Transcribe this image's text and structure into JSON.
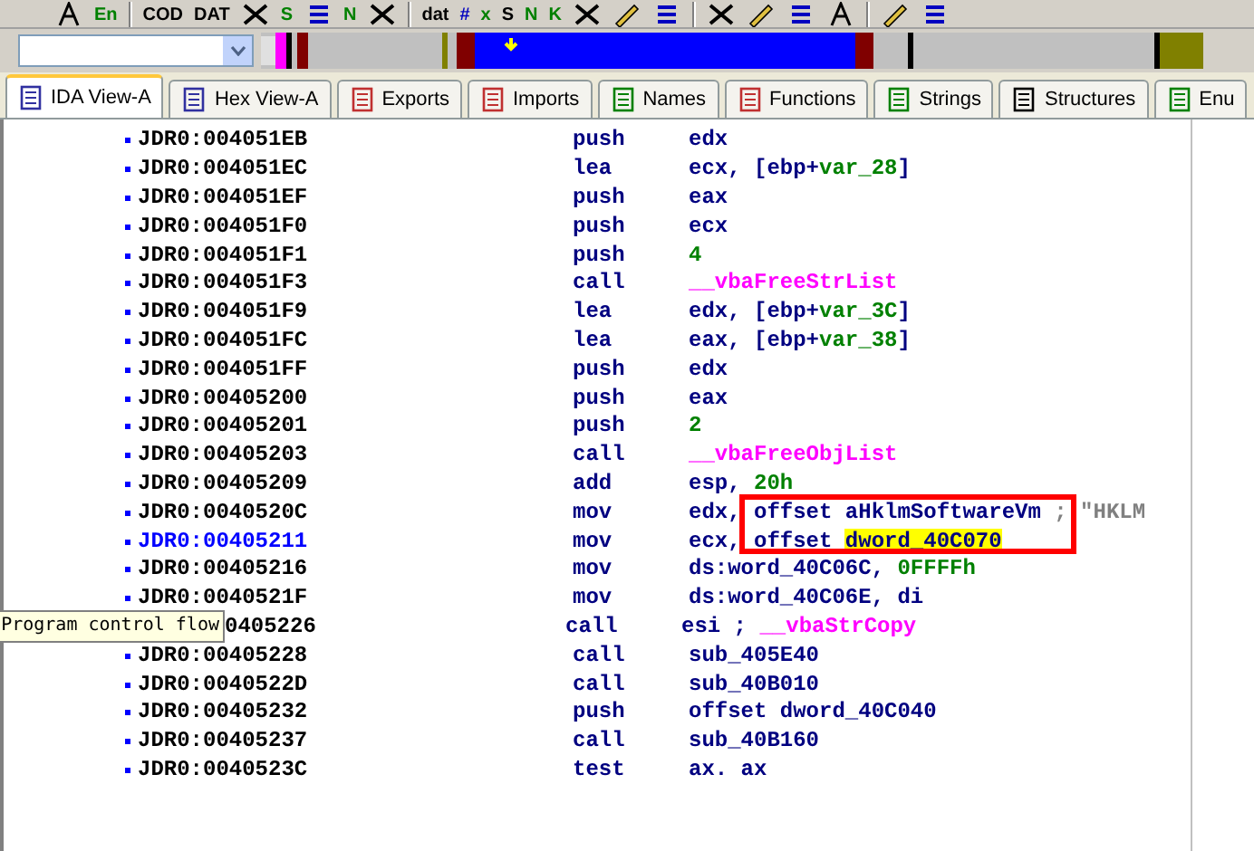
{
  "toolbar": [
    {
      "kind": "icon"
    },
    {
      "kind": "text",
      "label": "En",
      "color": "#008000"
    },
    {
      "kind": "sep"
    },
    {
      "kind": "text",
      "label": "COD",
      "color": "#000000"
    },
    {
      "kind": "text",
      "label": "DAT",
      "color": "#000000"
    },
    {
      "kind": "icon"
    },
    {
      "kind": "text",
      "label": "S",
      "color": "#008000"
    },
    {
      "kind": "icon"
    },
    {
      "kind": "text",
      "label": "N",
      "color": "#008000"
    },
    {
      "kind": "icon"
    },
    {
      "kind": "sep"
    },
    {
      "kind": "text",
      "label": "dat",
      "color": "#000000"
    },
    {
      "kind": "text",
      "label": "#",
      "color": "#0000c0"
    },
    {
      "kind": "text",
      "label": "x",
      "color": "#008000"
    },
    {
      "kind": "text",
      "label": "S",
      "color": "#000000"
    },
    {
      "kind": "text",
      "label": "N",
      "color": "#008000"
    },
    {
      "kind": "text",
      "label": "K",
      "color": "#008000"
    },
    {
      "kind": "icon"
    },
    {
      "kind": "icon"
    },
    {
      "kind": "icon"
    },
    {
      "kind": "sep"
    },
    {
      "kind": "icon"
    },
    {
      "kind": "icon"
    },
    {
      "kind": "icon"
    },
    {
      "kind": "icon"
    },
    {
      "kind": "sep"
    },
    {
      "kind": "icon"
    },
    {
      "kind": "icon"
    }
  ],
  "tabs": [
    {
      "label": "IDA View-A",
      "selected": true
    },
    {
      "label": "Hex View-A",
      "selected": false
    },
    {
      "label": "Exports",
      "selected": false
    },
    {
      "label": "Imports",
      "selected": false
    },
    {
      "label": "Names",
      "selected": false
    },
    {
      "label": "Functions",
      "selected": false
    },
    {
      "label": "Strings",
      "selected": false
    },
    {
      "label": "Structures",
      "selected": false
    },
    {
      "label": "Enu",
      "selected": false
    }
  ],
  "listing": [
    {
      "address": "JDR0:004051EB",
      "current": false,
      "mnemonic": "push",
      "operand": [
        {
          "kind": "reg",
          "text": "edx"
        }
      ]
    },
    {
      "address": "JDR0:004051EC",
      "current": false,
      "mnemonic": "lea",
      "operand": [
        {
          "kind": "reg",
          "text": "ecx, [ebp+"
        },
        {
          "kind": "var",
          "text": "var_28"
        },
        {
          "kind": "reg",
          "text": "]"
        }
      ]
    },
    {
      "address": "JDR0:004051EF",
      "current": false,
      "mnemonic": "push",
      "operand": [
        {
          "kind": "reg",
          "text": "eax"
        }
      ]
    },
    {
      "address": "JDR0:004051F0",
      "current": false,
      "mnemonic": "push",
      "operand": [
        {
          "kind": "reg",
          "text": "ecx"
        }
      ]
    },
    {
      "address": "JDR0:004051F1",
      "current": false,
      "mnemonic": "push",
      "operand": [
        {
          "kind": "num",
          "text": "4"
        }
      ]
    },
    {
      "address": "JDR0:004051F3",
      "current": false,
      "mnemonic": "call",
      "operand": [
        {
          "kind": "func",
          "text": "__vbaFreeStrList"
        }
      ]
    },
    {
      "address": "JDR0:004051F9",
      "current": false,
      "mnemonic": "lea",
      "operand": [
        {
          "kind": "reg",
          "text": "edx, [ebp+"
        },
        {
          "kind": "var",
          "text": "var_3C"
        },
        {
          "kind": "reg",
          "text": "]"
        }
      ]
    },
    {
      "address": "JDR0:004051FC",
      "current": false,
      "mnemonic": "lea",
      "operand": [
        {
          "kind": "reg",
          "text": "eax, [ebp+"
        },
        {
          "kind": "var",
          "text": "var_38"
        },
        {
          "kind": "reg",
          "text": "]"
        }
      ]
    },
    {
      "address": "JDR0:004051FF",
      "current": false,
      "mnemonic": "push",
      "operand": [
        {
          "kind": "reg",
          "text": "edx"
        }
      ]
    },
    {
      "address": "JDR0:00405200",
      "current": false,
      "mnemonic": "push",
      "operand": [
        {
          "kind": "reg",
          "text": "eax"
        }
      ]
    },
    {
      "address": "JDR0:00405201",
      "current": false,
      "mnemonic": "push",
      "operand": [
        {
          "kind": "num",
          "text": "2"
        }
      ]
    },
    {
      "address": "JDR0:00405203",
      "current": false,
      "mnemonic": "call",
      "operand": [
        {
          "kind": "func",
          "text": "__vbaFreeObjList"
        }
      ]
    },
    {
      "address": "JDR0:00405209",
      "current": false,
      "mnemonic": "add",
      "operand": [
        {
          "kind": "reg",
          "text": "esp, "
        },
        {
          "kind": "num",
          "text": "20h"
        }
      ]
    },
    {
      "address": "JDR0:0040520C",
      "current": false,
      "mnemonic": "mov",
      "operand": [
        {
          "kind": "reg",
          "text": "edx, offset aHklmSoftwareVm"
        },
        {
          "kind": "comment",
          "text": " ; \"HKLM"
        }
      ]
    },
    {
      "address": "JDR0:00405211",
      "current": true,
      "mnemonic": "mov",
      "operand": [
        {
          "kind": "reg",
          "text": "ecx, offset "
        },
        {
          "kind": "highlight",
          "text": "dword_40C070"
        }
      ]
    },
    {
      "address": "JDR0:00405216",
      "current": false,
      "mnemonic": "mov",
      "operand": [
        {
          "kind": "reg",
          "text": "ds:word_40C06C, "
        },
        {
          "kind": "num",
          "text": "0FFFFh"
        }
      ]
    },
    {
      "address": "JDR0:0040521F",
      "current": false,
      "mnemonic": "mov",
      "operand": [
        {
          "kind": "reg",
          "text": "ds:word_40C06E, di"
        }
      ]
    },
    {
      "address": "0405226",
      "tooltip": "Program control flow",
      "current": false,
      "mnemonic": "call",
      "operand": [
        {
          "kind": "reg",
          "text": "esi ; "
        },
        {
          "kind": "func",
          "text": "__vbaStrCopy"
        }
      ]
    },
    {
      "address": "JDR0:00405228",
      "current": false,
      "mnemonic": "call",
      "operand": [
        {
          "kind": "reg",
          "text": "sub_405E40"
        }
      ]
    },
    {
      "address": "JDR0:0040522D",
      "current": false,
      "mnemonic": "call",
      "operand": [
        {
          "kind": "reg",
          "text": "sub_40B010"
        }
      ]
    },
    {
      "address": "JDR0:00405232",
      "current": false,
      "mnemonic": "push",
      "operand": [
        {
          "kind": "reg",
          "text": "offset dword_40C040"
        }
      ]
    },
    {
      "address": "JDR0:00405237",
      "current": false,
      "mnemonic": "call",
      "operand": [
        {
          "kind": "reg",
          "text": "sub_40B160"
        }
      ]
    },
    {
      "address": "JDR0:0040523C",
      "current": false,
      "mnemonic": "test",
      "operand": [
        {
          "kind": "reg",
          "text": "ax. ax"
        }
      ]
    }
  ]
}
